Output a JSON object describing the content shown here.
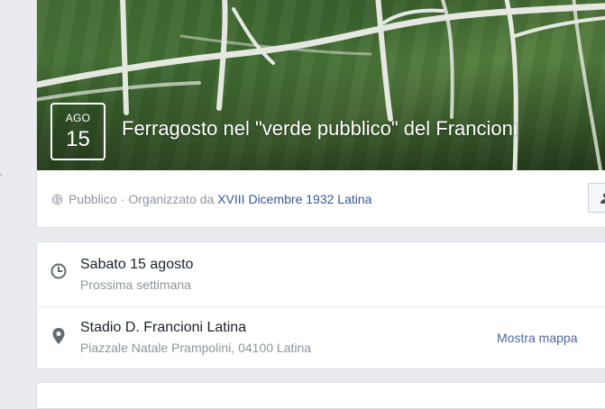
{
  "event": {
    "date": {
      "month": "AGO",
      "day": "15"
    },
    "title": "Ferragosto nel \"verde pubblico\" del Francioni",
    "privacy": "Pubblico",
    "separator": "·",
    "organized_by_label": "Organizzato da",
    "organizer": "XVIII Dicembre 1932 Latina"
  },
  "details": {
    "time": {
      "main": "Sabato 15 agosto",
      "sub": "Prossima settimana"
    },
    "location": {
      "main": "Stadio D. Francioni Latina",
      "sub": "Piazzale Natale Prampolini, 04100 Latina",
      "map_link": "Mostra mappa"
    }
  },
  "icons": {
    "privacy": "globe-icon",
    "time": "clock-icon",
    "location": "map-pin-icon",
    "join": "person-icon"
  },
  "colors": {
    "link": "#365899",
    "secondary_text": "#90949c",
    "primary_text": "#1d2129",
    "page_background": "#e9ebee"
  }
}
